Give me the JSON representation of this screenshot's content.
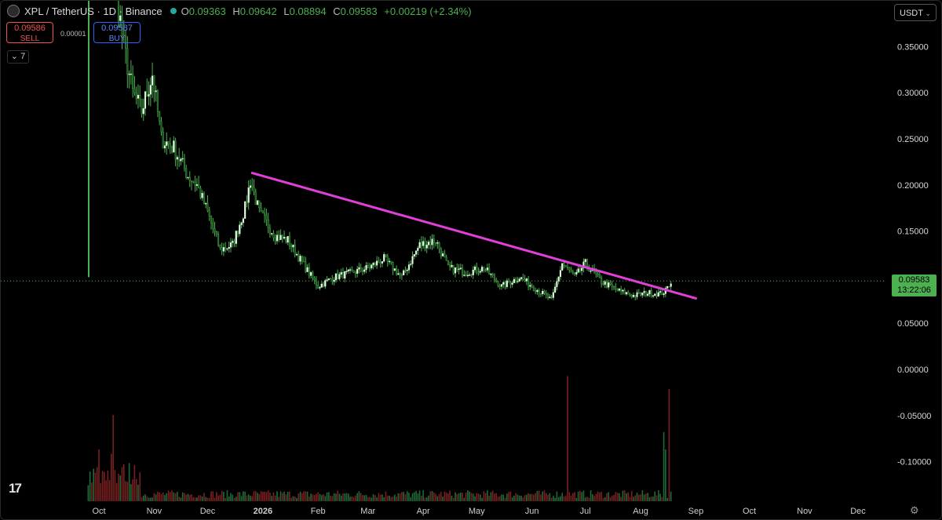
{
  "header": {
    "title": "XPL / TetherUS · 1D · Binance",
    "ohlc": [
      {
        "k": "O",
        "v": "0.09363"
      },
      {
        "k": "H",
        "v": "0.09642"
      },
      {
        "k": "L",
        "v": "0.08894"
      },
      {
        "k": "C",
        "v": "0.09583"
      }
    ],
    "change": "+0.00219 (+2.34%)"
  },
  "trade": {
    "sell_price": "0.09586",
    "sell_label": "SELL",
    "buy_price": "0.09587",
    "buy_label": "BUY",
    "spread": "0.00001"
  },
  "indicators_toggle": "7",
  "currency_selector": "USDT",
  "last_price": {
    "value": "0.09583",
    "countdown": "13:22:06"
  },
  "colors": {
    "up": "#4caf50",
    "down": "#ef5350",
    "trendline": "#e040d8",
    "volume_up": "#1e6b3a",
    "volume_down": "#7a2020"
  },
  "chart_data": {
    "type": "candlestick",
    "symbol": "XPL / TetherUS",
    "interval": "1D",
    "exchange": "Binance",
    "y_ticks": [
      0.35,
      0.3,
      0.25,
      0.2,
      0.15,
      0.1,
      0.05,
      0,
      -0.05,
      -0.1
    ],
    "y_tick_labels": [
      "0.35000",
      "0.30000",
      "0.25000",
      "0.20000",
      "0.15000",
      "0.10000",
      "0.05000",
      "0.00000",
      "-0.05000",
      "-0.10000"
    ],
    "x_labels": [
      "Oct",
      "Nov",
      "Dec",
      "2026",
      "Feb",
      "Mar",
      "Apr",
      "May",
      "Jun",
      "Jul",
      "Aug",
      "Sep",
      "Oct",
      "Nov",
      "Dec"
    ],
    "close_series": {
      "start": "2025-09-25",
      "end": "2026-08-18",
      "keypoints": [
        [
          "2025-09-25",
          0.68
        ],
        [
          "2025-09-28",
          0.75
        ],
        [
          "2025-10-05",
          0.52
        ],
        [
          "2025-10-10",
          0.42
        ],
        [
          "2025-10-15",
          0.35
        ],
        [
          "2025-10-20",
          0.3
        ],
        [
          "2025-10-25",
          0.28
        ],
        [
          "2025-10-31",
          0.32
        ],
        [
          "2025-11-05",
          0.25
        ],
        [
          "2025-11-12",
          0.24
        ],
        [
          "2025-11-20",
          0.21
        ],
        [
          "2025-11-25",
          0.2
        ],
        [
          "2025-12-01",
          0.17
        ],
        [
          "2025-12-08",
          0.13
        ],
        [
          "2025-12-15",
          0.135
        ],
        [
          "2025-12-22",
          0.175
        ],
        [
          "2025-12-25",
          0.205
        ],
        [
          "2025-12-30",
          0.17
        ],
        [
          "2026-01-08",
          0.145
        ],
        [
          "2026-01-15",
          0.14
        ],
        [
          "2026-01-25",
          0.11
        ],
        [
          "2026-02-01",
          0.09
        ],
        [
          "2026-02-10",
          0.1
        ],
        [
          "2026-02-20",
          0.105
        ],
        [
          "2026-03-01",
          0.11
        ],
        [
          "2026-03-10",
          0.12
        ],
        [
          "2026-03-20",
          0.1
        ],
        [
          "2026-03-30",
          0.135
        ],
        [
          "2026-04-08",
          0.14
        ],
        [
          "2026-04-15",
          0.11
        ],
        [
          "2026-04-25",
          0.105
        ],
        [
          "2026-05-05",
          0.11
        ],
        [
          "2026-05-15",
          0.09
        ],
        [
          "2026-05-25",
          0.1
        ],
        [
          "2026-06-05",
          0.085
        ],
        [
          "2026-06-12",
          0.075
        ],
        [
          "2026-06-18",
          0.115
        ],
        [
          "2026-06-25",
          0.1
        ],
        [
          "2026-07-01",
          0.115
        ],
        [
          "2026-07-10",
          0.095
        ],
        [
          "2026-07-20",
          0.085
        ],
        [
          "2026-07-28",
          0.08
        ],
        [
          "2026-08-05",
          0.083
        ],
        [
          "2026-08-12",
          0.082
        ],
        [
          "2026-08-15",
          0.085
        ],
        [
          "2026-08-18",
          0.0958
        ]
      ]
    },
    "trendline": {
      "start": [
        "2025-12-26",
        0.213
      ],
      "end": [
        "2026-09-01",
        0.077
      ]
    },
    "last_close": 0.09583,
    "volume": {
      "spikes": [
        [
          "2025-10-01",
          0.6
        ],
        [
          "2025-10-08",
          0.55
        ],
        [
          "2025-10-09",
          1.0
        ],
        [
          "2026-06-21",
          1.45
        ],
        [
          "2026-08-14",
          0.8
        ],
        [
          "2026-08-15",
          0.6
        ],
        [
          "2026-08-17",
          1.3
        ]
      ]
    },
    "notes": "Close series is estimated from the plotted candles; volume is relative height."
  }
}
